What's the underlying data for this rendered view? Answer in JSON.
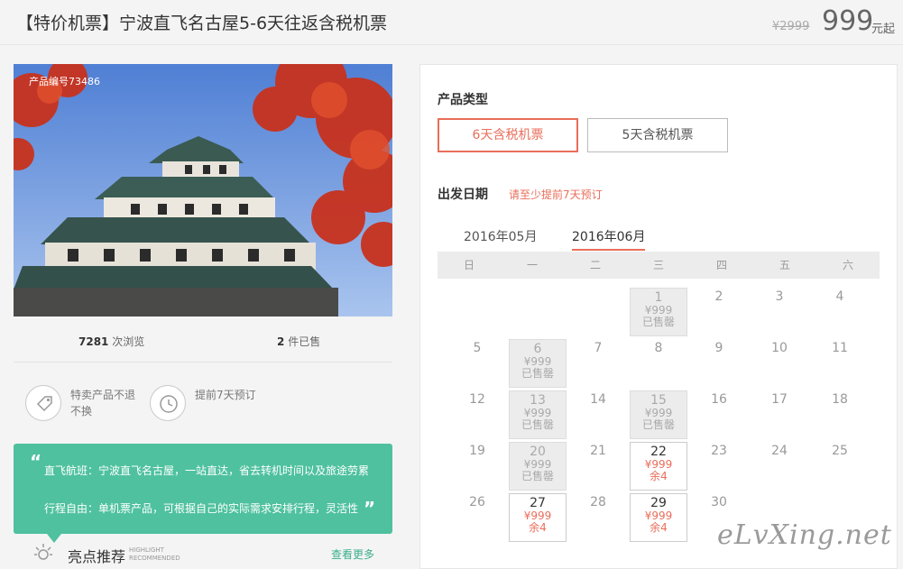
{
  "header": {
    "title": "【特价机票】宁波直飞名古屋5-6天往返含税机票",
    "original_price": "¥2999",
    "price": "999",
    "price_unit": "元起"
  },
  "photo": {
    "product_no": "产品编号73486"
  },
  "stats": {
    "views_count": "7281",
    "views_label": "次浏览",
    "sold_count": "2",
    "sold_label": "件已售"
  },
  "features": [
    {
      "icon": "tag-icon",
      "label": "特卖产品不退不换"
    },
    {
      "icon": "clock-icon",
      "label": "提前7天预订"
    }
  ],
  "highlight": {
    "line1": "直飞航班：宁波直飞名古屋，一站直达，省去转机时间以及旅途劳累",
    "line2": "行程自由：单机票产品，可根据自己的实际需求安排行程，灵活性"
  },
  "recommend": {
    "title": "亮点推荐",
    "subtitle_en_1": "HIGHLIGHT",
    "subtitle_en_2": "RECOMMENDED",
    "more": "查看更多"
  },
  "booking": {
    "product_type_label": "产品类型",
    "types": [
      "6天含税机票",
      "5天含税机票"
    ],
    "date_label": "出发日期",
    "date_hint": "请至少提前7天预订",
    "months": [
      "2016年05月",
      "2016年06月"
    ],
    "weekdays": [
      "日",
      "一",
      "二",
      "三",
      "四",
      "五",
      "六"
    ],
    "days": [
      {
        "day": "1",
        "price": "¥999",
        "status": "已售罄",
        "state": "sold"
      },
      {
        "day": "2"
      },
      {
        "day": "3"
      },
      {
        "day": "4"
      },
      {
        "day": "5"
      },
      {
        "day": "6",
        "price": "¥999",
        "status": "已售罄",
        "state": "sold"
      },
      {
        "day": "7"
      },
      {
        "day": "8"
      },
      {
        "day": "9"
      },
      {
        "day": "10"
      },
      {
        "day": "11"
      },
      {
        "day": "12"
      },
      {
        "day": "13",
        "price": "¥999",
        "status": "已售罄",
        "state": "sold"
      },
      {
        "day": "14"
      },
      {
        "day": "15",
        "price": "¥999",
        "status": "已售罄",
        "state": "sold"
      },
      {
        "day": "16"
      },
      {
        "day": "17"
      },
      {
        "day": "18"
      },
      {
        "day": "19"
      },
      {
        "day": "20",
        "price": "¥999",
        "status": "已售罄",
        "state": "sold"
      },
      {
        "day": "21"
      },
      {
        "day": "22",
        "price": "¥999",
        "status": "余4",
        "state": "avail"
      },
      {
        "day": "23"
      },
      {
        "day": "24"
      },
      {
        "day": "25"
      },
      {
        "day": "26"
      },
      {
        "day": "27",
        "price": "¥999",
        "status": "余4",
        "state": "avail"
      },
      {
        "day": "28"
      },
      {
        "day": "29",
        "price": "¥999",
        "status": "余4",
        "state": "avail"
      },
      {
        "day": "30"
      }
    ]
  },
  "watermark": "eLvXing.net"
}
